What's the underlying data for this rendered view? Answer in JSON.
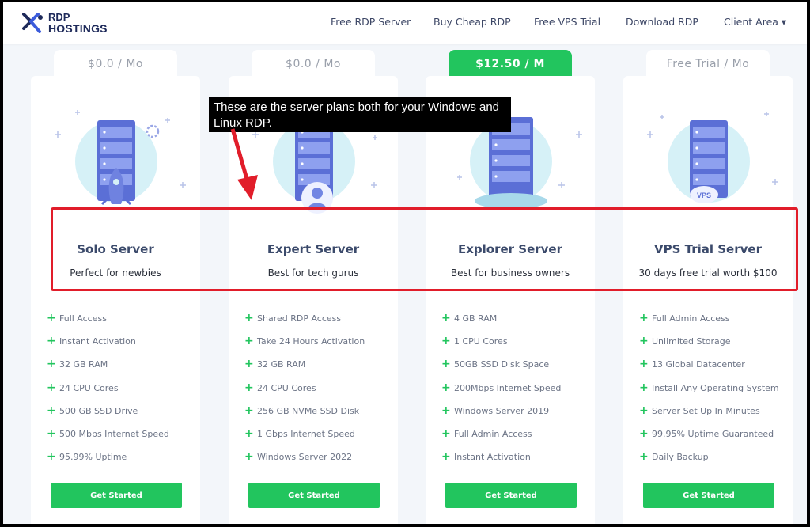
{
  "header": {
    "logo_line1": "RDP",
    "logo_line2": "HOSTINGS",
    "nav": [
      "Free RDP Server",
      "Buy Cheap RDP",
      "Free VPS Trial",
      "Download RDP",
      "Client Area ▾"
    ]
  },
  "plans": [
    {
      "price": "$0.0 / Mo",
      "name": "Solo Server",
      "tagline": "Perfect for newbies",
      "features": [
        "Full Access",
        "Instant Activation",
        "32 GB RAM",
        "24 CPU Cores",
        "500 GB SSD Drive",
        "500 Mbps Internet Speed",
        "95.99% Uptime"
      ],
      "button": "Get Started"
    },
    {
      "price": "$0.0 / Mo",
      "name": "Expert Server",
      "tagline": "Best for tech gurus",
      "features": [
        "Shared RDP Access",
        "Take 24 Hours Activation",
        "32 GB RAM",
        "24 CPU Cores",
        "256 GB NVMe SSD Disk",
        "1 Gbps Internet Speed",
        "Windows Server 2022"
      ],
      "button": "Get Started"
    },
    {
      "price": "$12.50 / M",
      "name": "Explorer Server",
      "tagline": "Best for business owners",
      "features": [
        "4 GB RAM",
        "1 CPU Cores",
        "50GB SSD Disk Space",
        "200Mbps Internet Speed",
        "Windows Server 2019",
        "Full Admin Access",
        "Instant Activation"
      ],
      "button": "Get Started"
    },
    {
      "price": "Free Trial / Mo",
      "name": "VPS Trial Server",
      "tagline": "30 days free trial worth $100",
      "features": [
        "Full Admin Access",
        "Unlimited Storage",
        "13 Global Datacenter",
        "Install Any Operating System",
        "Server Set Up In Minutes",
        "99.95% Uptime Guaranteed",
        "Daily Backup"
      ],
      "button": "Get Started"
    }
  ],
  "annotation": {
    "callout_text": "These are the server plans both for your Windows and Linux RDP."
  },
  "illustration_labels": {
    "vps_badge": "VPS"
  },
  "colors": {
    "accent_green": "#22c55e",
    "annotation_red": "#e11d2a",
    "brand_navy": "#1e2a5a",
    "server_blue": "#5b6fd6"
  }
}
